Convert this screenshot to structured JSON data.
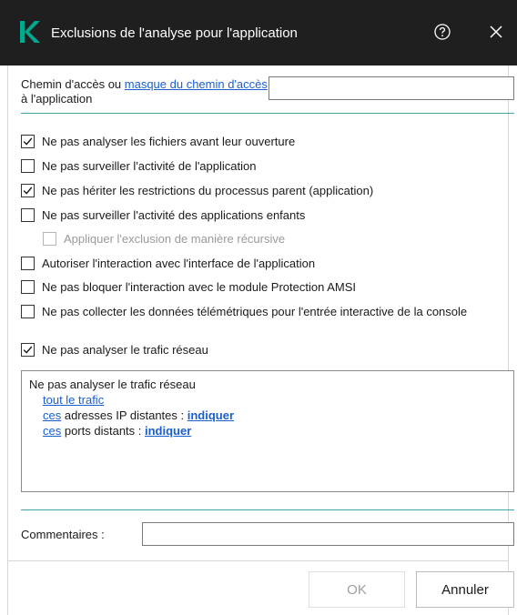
{
  "window": {
    "title": "Exclusions de l'analyse pour l'application"
  },
  "path": {
    "label_prefix": "Chemin d'accès ou ",
    "label_link": "masque du chemin d'accès",
    "label_suffix": " à l'application",
    "value": ""
  },
  "options": [
    {
      "label": "Ne pas analyser les fichiers avant leur ouverture",
      "checked": true,
      "disabled": false
    },
    {
      "label": "Ne pas surveiller l'activité de l'application",
      "checked": false,
      "disabled": false
    },
    {
      "label": "Ne pas hériter les restrictions du processus parent (application)",
      "checked": true,
      "disabled": false
    },
    {
      "label": "Ne pas surveiller l'activité des applications enfants",
      "checked": false,
      "disabled": false
    },
    {
      "label": "Appliquer l'exclusion de manière récursive",
      "checked": false,
      "disabled": true
    },
    {
      "label": "Autoriser l'interaction avec l'interface de l'application",
      "checked": false,
      "disabled": false
    },
    {
      "label": "Ne pas bloquer l'interaction avec le module Protection AMSI",
      "checked": false,
      "disabled": false
    },
    {
      "label": "Ne pas collecter les données télémétriques pour l'entrée interactive de la console",
      "checked": false,
      "disabled": false
    },
    {
      "label": "Ne pas analyser le trafic réseau",
      "checked": true,
      "disabled": false
    }
  ],
  "traffic": {
    "heading": "Ne pas analyser le trafic réseau",
    "all_traffic_link": "tout le trafic",
    "ip_link": "ces",
    "ip_text": " adresses IP distantes : ",
    "ip_specify": "indiquer",
    "ports_link": "ces",
    "ports_text": " ports distants : ",
    "ports_specify": "indiquer"
  },
  "comments": {
    "label": "Commentaires :",
    "value": ""
  },
  "buttons": {
    "ok": "OK",
    "cancel": "Annuler"
  },
  "colors": {
    "titlebar": "#1f1f1f",
    "accent_logo": "#00a88e",
    "link": "#1a5fcf",
    "separator": "#3fa6a6"
  },
  "icons": {
    "logo": "kaspersky-k-icon",
    "help": "help-circle-icon",
    "close": "close-icon"
  }
}
